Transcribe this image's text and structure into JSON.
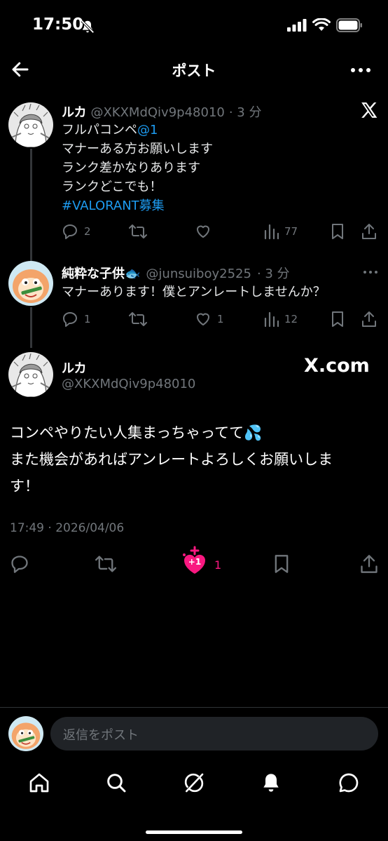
{
  "status_bar": {
    "time": "17:50"
  },
  "header": {
    "title": "ポスト"
  },
  "tweet1": {
    "name": "ルカ",
    "handle": "@XKXMdQiv9p48010",
    "time": "· 3 分",
    "text_before": "フルパコンペ",
    "text_mention": "@1",
    "text_after": "マナーある方お願いします\nランク差かなりあります\nランクどこでも！",
    "hashtag": "#VALORANT募集",
    "replies": "2",
    "views": "77"
  },
  "tweet2": {
    "name": "純粋な子供🐟",
    "handle": "@junsuiboy2525",
    "time": "· 3 分",
    "text": "マナーあります！僕とアンレートしませんか？",
    "replies": "1",
    "likes": "1",
    "views": "12"
  },
  "main_tweet": {
    "name": "ルカ",
    "handle": "@XKXMdQiv9p48010",
    "watermark": "X.com",
    "text_line1": "コンペやりたい人集まっちゃってて💦",
    "text_line2": "また機会があればアンレートよろしくお願いしま",
    "text_line3": "す！",
    "timestamp": "17:49 · 2026/04/06",
    "like_badge": "+1",
    "likes": "1"
  },
  "reply": {
    "placeholder": "返信をポスト"
  },
  "colors": {
    "accent": "#1d9bf0",
    "like": "#f91880",
    "bg": "#000000"
  },
  "icons": [
    "back-arrow-icon",
    "more-icon",
    "x-logo-icon",
    "reply-icon",
    "retweet-icon",
    "like-icon",
    "views-icon",
    "bookmark-icon",
    "share-icon",
    "home-icon",
    "search-icon",
    "grok-icon",
    "notifications-icon",
    "messages-icon"
  ]
}
